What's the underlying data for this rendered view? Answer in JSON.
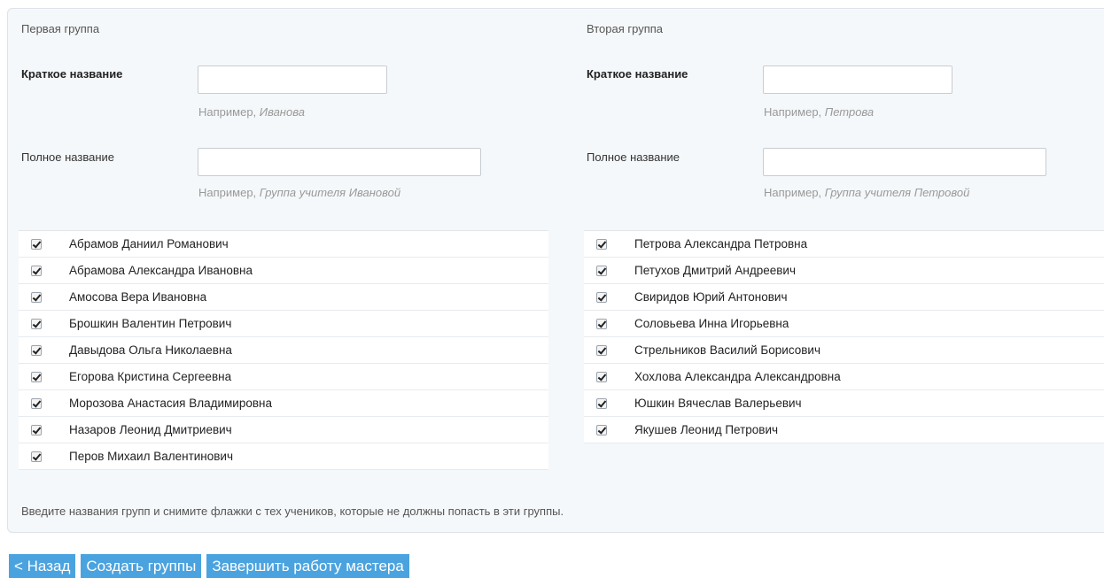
{
  "group1": {
    "title": "Первая группа",
    "short_label": "Краткое название",
    "short_value": "",
    "short_hint_prefix": "Например, ",
    "short_hint_example": "Иванова",
    "full_label": "Полное название",
    "full_value": "",
    "full_hint_prefix": "Например, ",
    "full_hint_example": "Группа учителя Ивановой",
    "students": [
      {
        "name": "Абрамов Даниил Романович",
        "checked": true
      },
      {
        "name": "Абрамова Александра Ивановна",
        "checked": true
      },
      {
        "name": "Амосова Вера Ивановна",
        "checked": true
      },
      {
        "name": "Брошкин Валентин Петрович",
        "checked": true
      },
      {
        "name": "Давыдова Ольга Николаевна",
        "checked": true
      },
      {
        "name": "Егорова Кристина Сергеевна",
        "checked": true
      },
      {
        "name": "Морозова Анастасия Владимировна",
        "checked": true
      },
      {
        "name": "Назаров Леонид Дмитриевич",
        "checked": true
      },
      {
        "name": "Перов Михаил Валентинович",
        "checked": true
      }
    ]
  },
  "group2": {
    "title": "Вторая группа",
    "short_label": "Краткое название",
    "short_value": "",
    "short_hint_prefix": "Например, ",
    "short_hint_example": "Петрова",
    "full_label": "Полное название",
    "full_value": "",
    "full_hint_prefix": "Например, ",
    "full_hint_example": "Группа учителя Петровой",
    "students": [
      {
        "name": "Петрова Александра Петровна",
        "checked": true
      },
      {
        "name": "Петухов Дмитрий Андреевич",
        "checked": true
      },
      {
        "name": "Свиридов Юрий Антонович",
        "checked": true
      },
      {
        "name": "Соловьева Инна Игорьевна",
        "checked": true
      },
      {
        "name": "Стрельников Василий Борисович",
        "checked": true
      },
      {
        "name": "Хохлова Александра Александровна",
        "checked": true
      },
      {
        "name": "Юшкин Вячеслав Валерьевич",
        "checked": true
      },
      {
        "name": "Якушев Леонид Петрович",
        "checked": true
      }
    ]
  },
  "instruction": "Введите названия групп и снимите флажки с тех учеников, которые не должны попасть в эти группы.",
  "buttons": {
    "back": "< Назад",
    "create": "Создать группы",
    "finish": "Завершить работу мастера"
  },
  "colors": {
    "button_bg": "#4aa3df",
    "panel_bg": "#f5f8fa"
  }
}
